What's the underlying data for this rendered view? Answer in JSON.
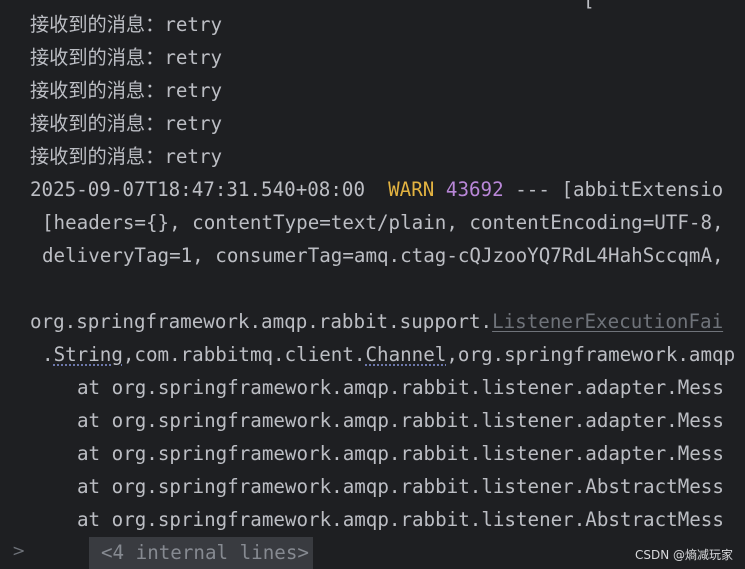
{
  "console": {
    "top_fragment": "[",
    "received": [
      {
        "label": "接收到的消息：",
        "value": "retry"
      },
      {
        "label": "接收到的消息：",
        "value": "retry"
      },
      {
        "label": "接收到的消息：",
        "value": "retry"
      },
      {
        "label": "接收到的消息：",
        "value": "retry"
      },
      {
        "label": "接收到的消息：",
        "value": "retry"
      }
    ],
    "log": {
      "timestamp": "2025-09-07T18:47:31.540+08:00",
      "level": "WARN",
      "pid": "43692",
      "rest": "--- [abbitExtensio",
      "line2": "[headers={}, contentType=text/plain, contentEncoding=UTF-8,",
      "line3": "deliveryTag=1, consumerTag=amq.ctag-cQJzooYQ7RdL4HahSccqmA,"
    },
    "exception": {
      "prefix": "org.springframework.amqp.rabbit.support.",
      "class_link": "ListenerExecutionFai",
      "sig_dot": ".",
      "sig_string": "String",
      "sig_mid": ",com.rabbitmq.client.",
      "sig_channel": "Channel",
      "sig_end": ",org.springframework.amqp"
    },
    "stack": [
      "at org.springframework.amqp.rabbit.listener.adapter.Mess",
      "at org.springframework.amqp.rabbit.listener.adapter.Mess",
      "at org.springframework.amqp.rabbit.listener.adapter.Mess",
      "at org.springframework.amqp.rabbit.listener.AbstractMess",
      "at org.springframework.amqp.rabbit.listener.AbstractMess"
    ],
    "fold": {
      "arrow": ">",
      "label": "<4 internal lines>"
    }
  },
  "watermark": "CSDN @熵减玩家",
  "colors": {
    "background": "#1e1f22",
    "text": "#bcbec4",
    "warn": "#e3b341",
    "pid": "#b987d8",
    "link": "#6f737a",
    "fold_bg": "#393b40"
  }
}
